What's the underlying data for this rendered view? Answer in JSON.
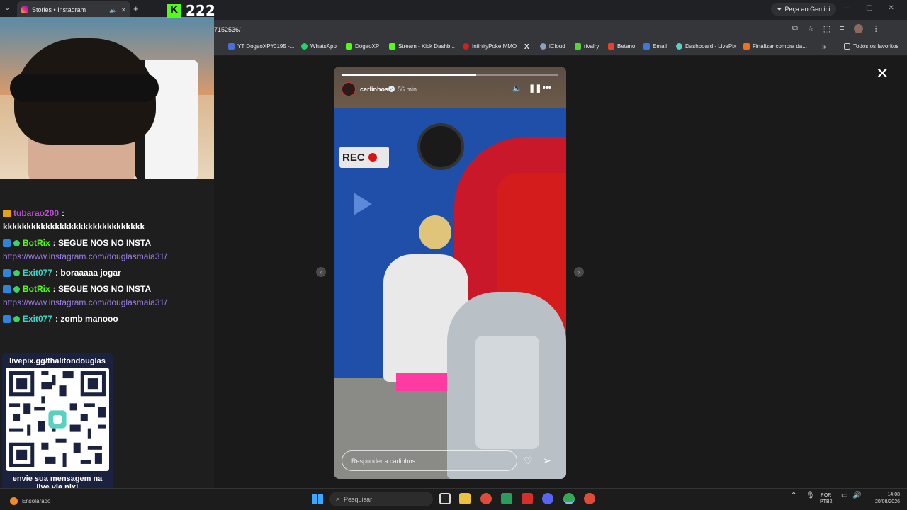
{
  "browser": {
    "tab_title": "Stories • Instagram",
    "url": "7152536/",
    "gemini_label": "Peça ao Gemini",
    "bookmarks": [
      {
        "label": "YT DogaoXP#0195 -...",
        "color": "#4a6fd8"
      },
      {
        "label": "WhatsApp",
        "color": "#25d366"
      },
      {
        "label": "DogaoXP",
        "color": "#53fc18"
      },
      {
        "label": "Stream - Kick Dashb...",
        "color": "#53fc18"
      },
      {
        "label": "InfinityPoke MMO",
        "color": "#d02020"
      },
      {
        "label": "X",
        "color": "#000000"
      },
      {
        "label": "iCloud",
        "color": "#8aa0c0"
      },
      {
        "label": "rivalry",
        "color": "#53d63a"
      },
      {
        "label": "Betano",
        "color": "#e8402a"
      },
      {
        "label": "Email",
        "color": "#3a7ad8"
      },
      {
        "label": "Dashboard - LivePix",
        "color": "#5ad0c0"
      },
      {
        "label": "Finalizar compra da...",
        "color": "#f07020"
      }
    ],
    "all_bookmarks_label": "Todos os favoritos"
  },
  "stream": {
    "viewer_count": "222",
    "kick_logo": "K"
  },
  "chat": [
    {
      "user": "tubarao200",
      "user_color": "#c04cd8",
      "message": " :",
      "continuation": "kkkkkkkkkkkkkkkkkkkkkkkkkkkkkk",
      "badges": [
        "crown"
      ]
    },
    {
      "user": "BotRix",
      "user_color": "#53fc18",
      "message": " : SEGUE NOS NO INSTA",
      "link": "https://www.instagram.com/douglasmaia31/",
      "badges": [
        "mod",
        "verified"
      ]
    },
    {
      "user": "Exit077",
      "user_color": "#3fd6c8",
      "message": " : boraaaaa jogar",
      "badges": [
        "mod",
        "verified"
      ]
    },
    {
      "user": "BotRix",
      "user_color": "#53fc18",
      "message": " : SEGUE NOS NO INSTA",
      "link": "https://www.instagram.com/douglasmaia31/",
      "badges": [
        "mod",
        "verified"
      ]
    },
    {
      "user": "Exit077",
      "user_color": "#3fd6c8",
      "message": " : zomb manooo",
      "badges": [
        "mod",
        "verified"
      ]
    }
  ],
  "livepix": {
    "title": "livepix.gg/thalitondouglas",
    "footer_line1": "envie sua mensagem na",
    "footer_line2": "live via pix!"
  },
  "story": {
    "username": "carlinhos",
    "time": "56 min",
    "progress": 0.62,
    "reply_placeholder": "Responder a carlinhos...",
    "rec_label": "REC"
  },
  "taskbar": {
    "weather": "Ensolarado",
    "search_placeholder": "Pesquisar",
    "lang_line1": "POR",
    "lang_line2": "PTB2",
    "time": "14:08",
    "date": "20/08/2026"
  }
}
